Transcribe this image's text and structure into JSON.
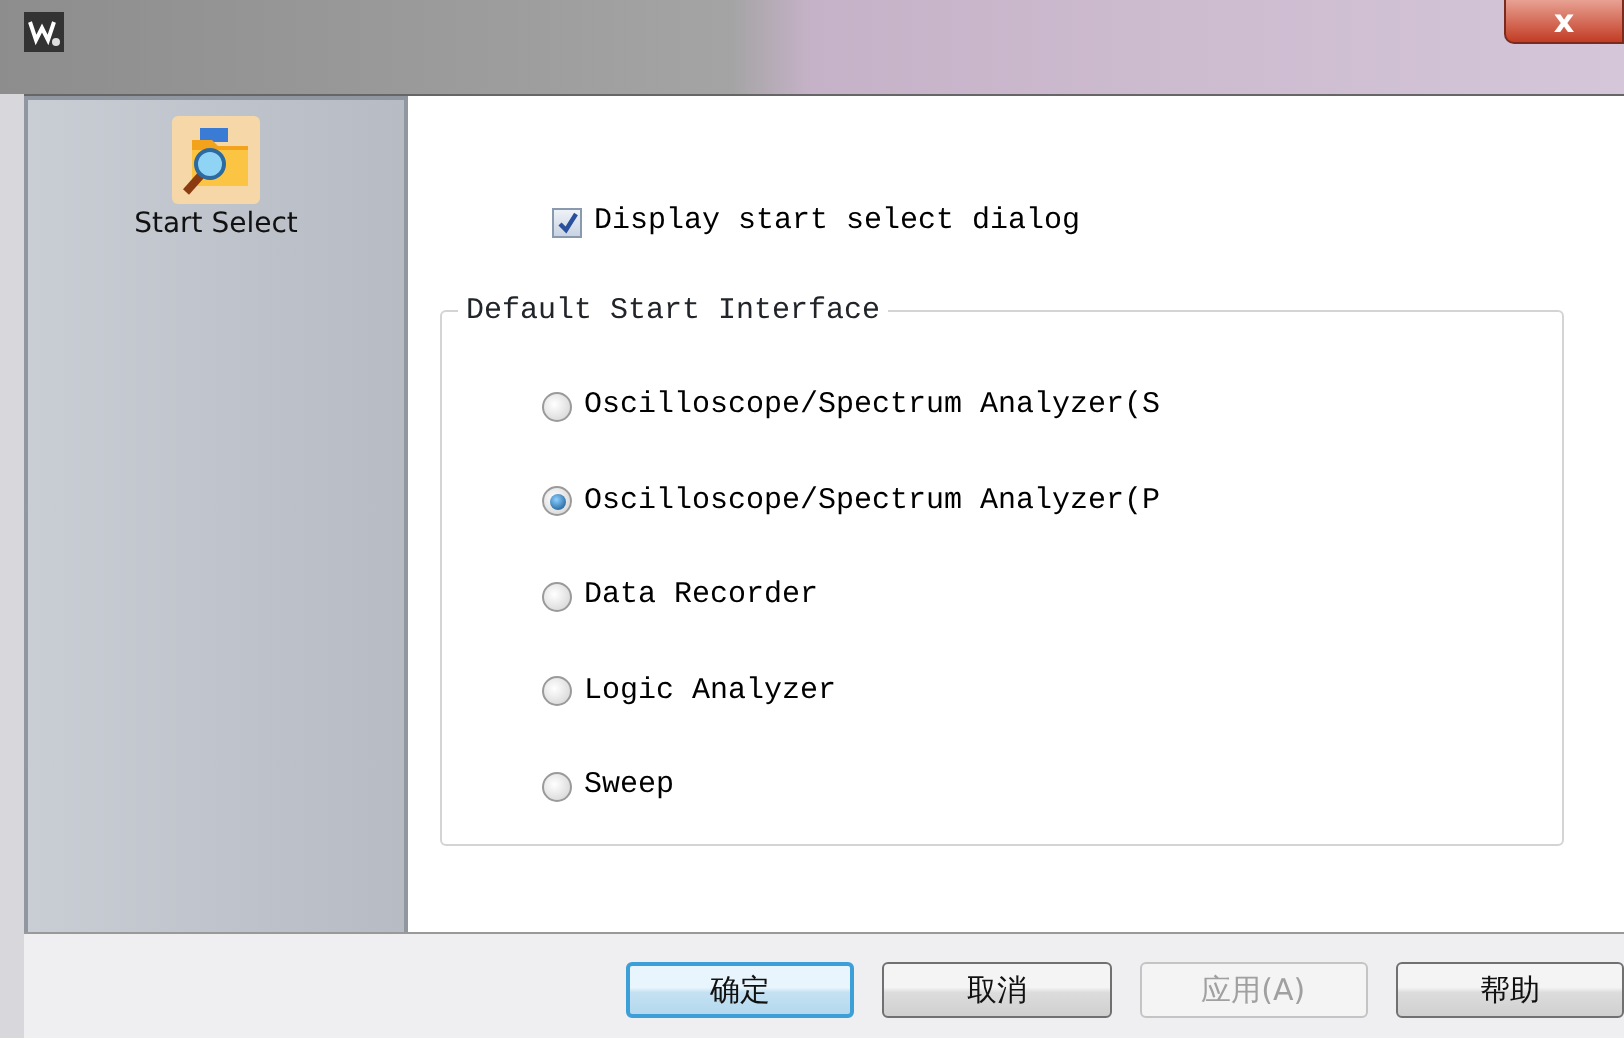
{
  "window": {
    "close_label": "x"
  },
  "sidebar": {
    "items": [
      {
        "label": "Start Select",
        "selected": true
      }
    ]
  },
  "show_dialog": {
    "label": "Display start select dialog",
    "checked": true
  },
  "group": {
    "title": "Default Start Interface",
    "options": [
      {
        "label": "Oscilloscope/Spectrum Analyzer(S",
        "selected": false
      },
      {
        "label": "Oscilloscope/Spectrum Analyzer(P",
        "selected": true
      },
      {
        "label": "Data Recorder",
        "selected": false
      },
      {
        "label": "Logic Analyzer",
        "selected": false
      },
      {
        "label": "Sweep",
        "selected": false
      }
    ]
  },
  "buttons": [
    {
      "label": "确定",
      "default": true,
      "disabled": false
    },
    {
      "label": "取消",
      "default": false,
      "disabled": false
    },
    {
      "label": "应用(A)",
      "default": false,
      "disabled": true
    },
    {
      "label": "帮助",
      "default": false,
      "disabled": false
    }
  ]
}
